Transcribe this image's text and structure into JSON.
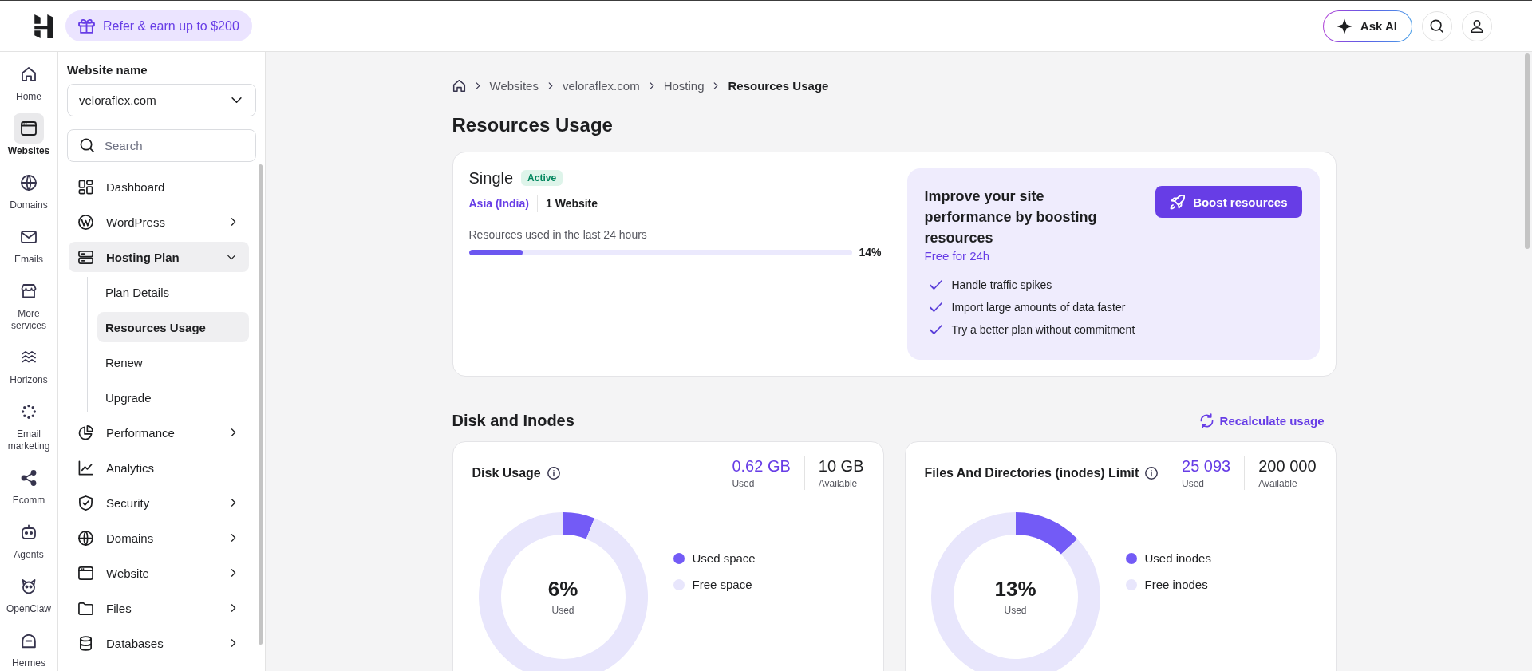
{
  "top_bar": {
    "refer_button": "Refer & earn up to $200",
    "ask_ai_button": "Ask AI"
  },
  "rail": [
    {
      "label": "Home",
      "selected": false
    },
    {
      "label": "Websites",
      "selected": true
    },
    {
      "label": "Domains",
      "selected": false
    },
    {
      "label": "Emails",
      "selected": false
    },
    {
      "label": "More services",
      "selected": false
    },
    {
      "label": "Horizons",
      "selected": false
    },
    {
      "label": "Email marketing",
      "selected": false
    },
    {
      "label": "Ecomm",
      "selected": false
    },
    {
      "label": "Agents",
      "selected": false
    },
    {
      "label": "OpenClaw",
      "selected": false
    },
    {
      "label": "Hermes",
      "selected": false
    }
  ],
  "sidebar": {
    "website_label": "Website name",
    "website_select": "veloraflex.com",
    "search": {
      "placeholder": "Search"
    },
    "items": [
      {
        "label": "Dashboard",
        "selected": false,
        "has_submenu": false
      },
      {
        "label": "WordPress",
        "selected": false,
        "has_submenu": true,
        "expanded": false
      },
      {
        "label": "Hosting Plan",
        "selected": true,
        "has_submenu": true,
        "expanded": true,
        "children": [
          {
            "label": "Plan Details",
            "selected": false
          },
          {
            "label": "Resources Usage",
            "selected": true
          },
          {
            "label": "Renew",
            "selected": false
          },
          {
            "label": "Upgrade",
            "selected": false
          }
        ]
      },
      {
        "label": "Performance",
        "selected": false,
        "has_submenu": true,
        "expanded": false
      },
      {
        "label": "Analytics",
        "selected": false,
        "has_submenu": false
      },
      {
        "label": "Security",
        "selected": false,
        "has_submenu": true,
        "expanded": false
      },
      {
        "label": "Domains",
        "selected": false,
        "has_submenu": true,
        "expanded": false
      },
      {
        "label": "Website",
        "selected": false,
        "has_submenu": true,
        "expanded": false
      },
      {
        "label": "Files",
        "selected": false,
        "has_submenu": true,
        "expanded": false
      },
      {
        "label": "Databases",
        "selected": false,
        "has_submenu": true,
        "expanded": false
      }
    ]
  },
  "breadcrumb": [
    {
      "label": "Websites",
      "current": false
    },
    {
      "label": "veloraflex.com",
      "current": false
    },
    {
      "label": "Hosting",
      "current": false
    },
    {
      "label": "Resources Usage",
      "current": true
    }
  ],
  "page_title": "Resources Usage",
  "plan_card": {
    "plan_name": "Single",
    "status_badge": "Active",
    "location": "Asia (India)",
    "websites": "1 Website",
    "usage_label": "Resources used in the last 24 hours",
    "usage": {
      "level": 0.14,
      "reading": "14%"
    },
    "promo": {
      "title": "Improve your site performance by boosting resources",
      "subtitle": "Free for 24h",
      "benefits": [
        "Handle traffic spikes",
        "Import large amounts of data faster",
        "Try a better plan without commitment"
      ],
      "button": "Boost resources"
    }
  },
  "disk_section": {
    "title": "Disk and Inodes",
    "recalculate_link": "Recalculate usage",
    "cards": [
      {
        "title": "Disk Usage",
        "used_value": "0.62 GB",
        "used_label": "Used",
        "available_value": "10 GB",
        "available_label": "Available",
        "center_value": "6%",
        "center_label": "Used",
        "chart_data": {
          "type": "donut",
          "categories": [
            "Used space",
            "Free space"
          ],
          "values": [
            6,
            94
          ]
        },
        "legend": [
          {
            "color": "#735bf6"
          },
          {
            "color": "#e8e6fc"
          }
        ]
      },
      {
        "title": "Files And Directories (inodes) Limit",
        "used_value": "25 093",
        "used_label": "Used",
        "available_value": "200 000",
        "available_label": "Available",
        "center_value": "13%",
        "center_label": "Used",
        "chart_data": {
          "type": "donut",
          "categories": [
            "Used inodes",
            "Free inodes"
          ],
          "values": [
            13,
            87
          ]
        },
        "legend": [
          {
            "color": "#735bf6"
          },
          {
            "color": "#e8e6fc"
          }
        ]
      }
    ]
  }
}
